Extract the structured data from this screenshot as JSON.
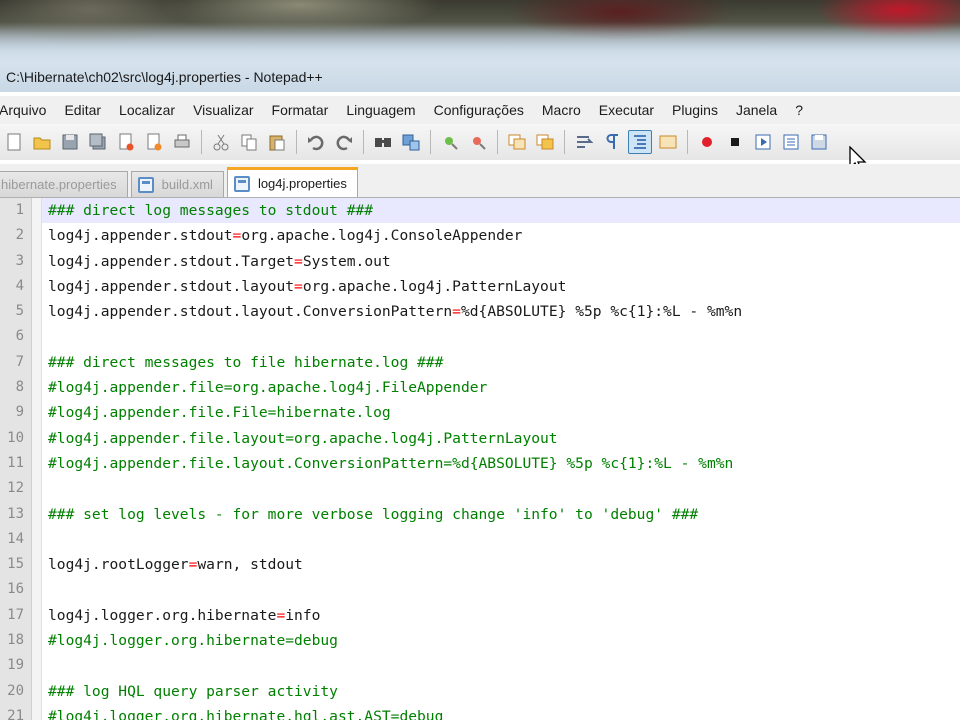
{
  "window": {
    "title": "C:\\Hibernate\\ch02\\src\\log4j.properties - Notepad++"
  },
  "menu": [
    "Arquivo",
    "Editar",
    "Localizar",
    "Visualizar",
    "Formatar",
    "Linguagem",
    "Configurações",
    "Macro",
    "Executar",
    "Plugins",
    "Janela",
    "?"
  ],
  "tabs": [
    {
      "label": "hibernate.properties",
      "active": false
    },
    {
      "label": "build.xml",
      "active": false
    },
    {
      "label": "log4j.properties",
      "active": true
    }
  ],
  "editor": {
    "lines": [
      {
        "n": "1",
        "kind": "comment",
        "text": "### direct log messages to stdout ###"
      },
      {
        "n": "2",
        "kind": "kv",
        "key": "log4j.appender.stdout",
        "value": "org.apache.log4j.ConsoleAppender"
      },
      {
        "n": "3",
        "kind": "kv",
        "key": "log4j.appender.stdout.Target",
        "value": "System.out"
      },
      {
        "n": "4",
        "kind": "kv",
        "key": "log4j.appender.stdout.layout",
        "value": "org.apache.log4j.PatternLayout"
      },
      {
        "n": "5",
        "kind": "kv",
        "key": "log4j.appender.stdout.layout.ConversionPattern",
        "value": "%d{ABSOLUTE} %5p %c{1}:%L - %m%n"
      },
      {
        "n": "6",
        "kind": "blank",
        "text": ""
      },
      {
        "n": "7",
        "kind": "comment",
        "text": "### direct messages to file hibernate.log ###"
      },
      {
        "n": "8",
        "kind": "comment",
        "text": "#log4j.appender.file=org.apache.log4j.FileAppender"
      },
      {
        "n": "9",
        "kind": "comment",
        "text": "#log4j.appender.file.File=hibernate.log"
      },
      {
        "n": "10",
        "kind": "comment",
        "text": "#log4j.appender.file.layout=org.apache.log4j.PatternLayout"
      },
      {
        "n": "11",
        "kind": "comment",
        "text": "#log4j.appender.file.layout.ConversionPattern=%d{ABSOLUTE} %5p %c{1}:%L - %m%n"
      },
      {
        "n": "12",
        "kind": "blank",
        "text": ""
      },
      {
        "n": "13",
        "kind": "comment",
        "text": "### set log levels - for more verbose logging change 'info' to 'debug' ###"
      },
      {
        "n": "14",
        "kind": "blank",
        "text": ""
      },
      {
        "n": "15",
        "kind": "kv",
        "key": "log4j.rootLogger",
        "value": "warn, stdout"
      },
      {
        "n": "16",
        "kind": "blank",
        "text": ""
      },
      {
        "n": "17",
        "kind": "kv",
        "key": "log4j.logger.org.hibernate",
        "value": "info"
      },
      {
        "n": "18",
        "kind": "comment",
        "text": "#log4j.logger.org.hibernate=debug"
      },
      {
        "n": "19",
        "kind": "blank",
        "text": ""
      },
      {
        "n": "20",
        "kind": "comment",
        "text": "### log HQL query parser activity"
      },
      {
        "n": "21",
        "kind": "comment",
        "text": "#log4j.logger.org.hibernate.hql.ast.AST=debug"
      }
    ]
  },
  "colors": {
    "comment": "#008000",
    "operator": "#ff0000",
    "active_tab_accent": "#f5a623"
  }
}
